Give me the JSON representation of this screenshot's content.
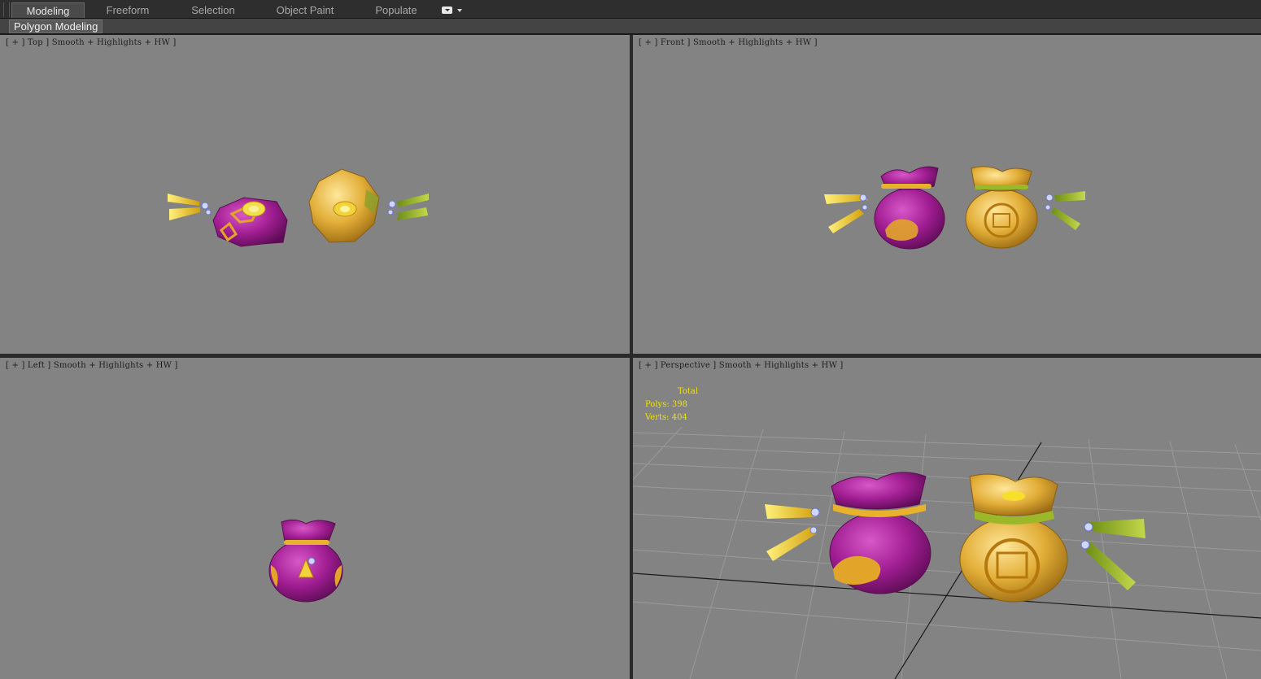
{
  "ribbon": {
    "tabs": [
      {
        "label": "Modeling",
        "active": true
      },
      {
        "label": "Freeform",
        "active": false
      },
      {
        "label": "Selection",
        "active": false
      },
      {
        "label": "Object Paint",
        "active": false
      },
      {
        "label": "Populate",
        "active": false
      }
    ],
    "panel_label": "Polygon Modeling"
  },
  "viewports": {
    "top": {
      "label": "[ + ] Top ] Smooth + Highlights + HW ]"
    },
    "front": {
      "label": "[ + ] Front ] Smooth + Highlights + HW ]"
    },
    "left": {
      "label": "[ + ] Left ] Smooth + Highlights + HW ]"
    },
    "perspective": {
      "label": "[ + ] Perspective ] Smooth + Highlights + HW ]"
    }
  },
  "stats": {
    "title": "Total",
    "polys_label": "Polys:",
    "polys_value": "398",
    "verts_label": "Verts:",
    "verts_value": "404"
  },
  "colors": {
    "viewport_bg": "#838383",
    "purple_bag": "#a01e92",
    "gold_bag": "#e7b53a",
    "tassel_yellow": "#f2cc1c",
    "tassel_green": "#9cb82a",
    "stats_text": "#f2e200"
  }
}
